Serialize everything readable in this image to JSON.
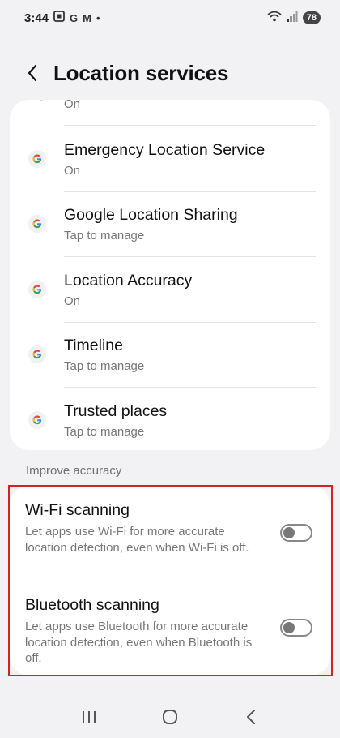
{
  "status_bar": {
    "time": "3:44",
    "notification_icons": [
      "screenshot-icon",
      "google-icon",
      "gmail-icon",
      "dot-icon"
    ],
    "g_glyph": "G",
    "m_glyph": "M",
    "dot_glyph": "•",
    "battery": "78"
  },
  "header": {
    "title": "Location services"
  },
  "services": {
    "partial_item": {
      "subtitle": "On"
    },
    "items": [
      {
        "title": "Emergency Location Service",
        "subtitle": "On"
      },
      {
        "title": "Google Location Sharing",
        "subtitle": "Tap to manage"
      },
      {
        "title": "Location Accuracy",
        "subtitle": "On"
      },
      {
        "title": "Timeline",
        "subtitle": "Tap to manage"
      },
      {
        "title": "Trusted places",
        "subtitle": "Tap to manage"
      }
    ]
  },
  "improve_accuracy": {
    "label": "Improve accuracy",
    "wifi": {
      "title": "Wi-Fi scanning",
      "desc": "Let apps use Wi-Fi for more accurate location detection, even when Wi-Fi is off.",
      "enabled": false
    },
    "bluetooth": {
      "title": "Bluetooth scanning",
      "desc": "Let apps use Bluetooth for more accurate location detection, even when Bluetooth is off.",
      "enabled": false
    }
  },
  "colors": {
    "background": "#f2f2f5",
    "card": "#ffffff",
    "highlight": "#d42027",
    "google_blue": "#4285F4",
    "google_red": "#EA4335",
    "google_yellow": "#FBBC05",
    "google_green": "#34A853"
  },
  "nav_bar": {
    "buttons": [
      "recent-apps-icon",
      "home-icon",
      "back-icon"
    ]
  }
}
